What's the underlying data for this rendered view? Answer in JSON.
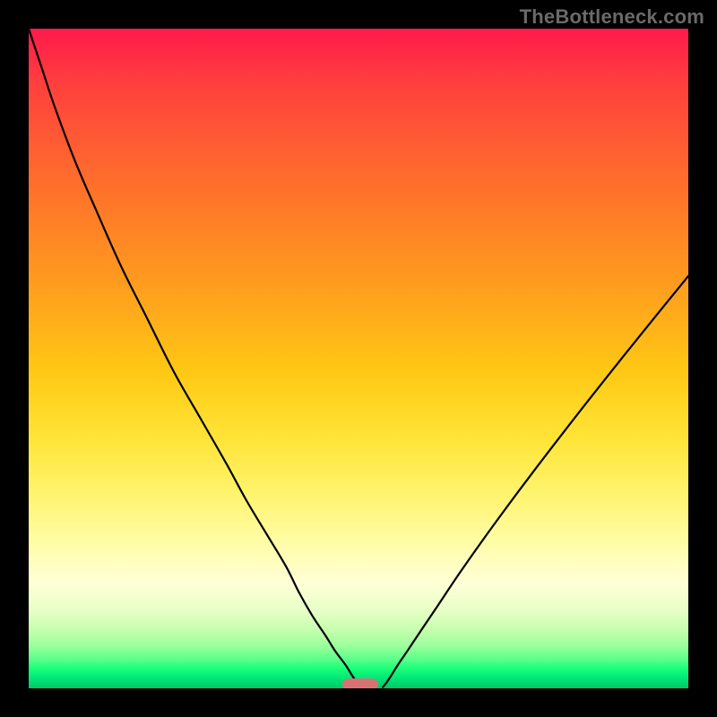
{
  "watermark": "TheBottleneck.com",
  "chart_data": {
    "type": "line",
    "title": "",
    "xlabel": "",
    "ylabel": "",
    "xlim": [
      0,
      100
    ],
    "ylim": [
      0,
      100
    ],
    "gradient_zones": [
      {
        "name": "bad-high",
        "color": "#ff1a4a",
        "pos": 0
      },
      {
        "name": "warn-mid",
        "color": "#ffe437",
        "pos": 62
      },
      {
        "name": "good-low",
        "color": "#00c866",
        "pos": 100
      }
    ],
    "series": [
      {
        "name": "left-branch",
        "x": [
          0,
          2,
          4,
          7,
          10,
          14,
          18,
          22,
          26,
          30,
          33,
          36,
          39,
          41,
          43,
          45,
          46.5,
          48,
          49,
          49.8,
          50.3
        ],
        "y": [
          100,
          94,
          88,
          80,
          73,
          64,
          56,
          48,
          41,
          34,
          28.5,
          23.5,
          18.5,
          14.5,
          11,
          8,
          5.6,
          3.6,
          2.0,
          0.8,
          0.2
        ]
      },
      {
        "name": "right-branch",
        "x": [
          53.7,
          54.2,
          55,
          56,
          57.5,
          59.5,
          62,
          65,
          68.5,
          72.5,
          77,
          82,
          87.5,
          93.5,
          100
        ],
        "y": [
          0.2,
          0.8,
          2.0,
          3.6,
          5.8,
          8.8,
          12.5,
          17,
          22,
          27.5,
          33.5,
          40,
          47,
          54.5,
          62.5
        ]
      }
    ],
    "marker": {
      "x": 50.3,
      "width": 5.5,
      "y": 0,
      "color": "#d87272"
    }
  }
}
